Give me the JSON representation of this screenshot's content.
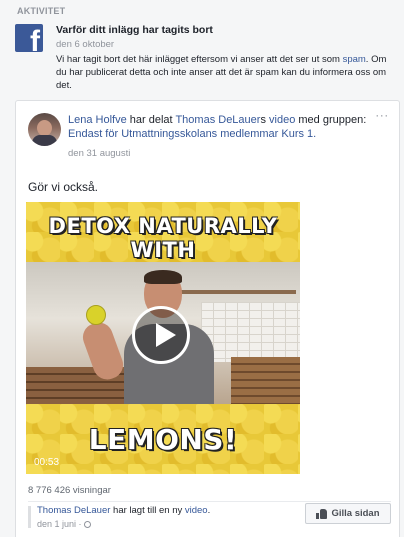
{
  "section_label": "AKTIVITET",
  "notice": {
    "logo_letter": "f",
    "title": "Varför ditt inlägg har tagits bort",
    "date": "den 6 oktober",
    "body_pre": "Vi har tagit bort det här inlägget eftersom vi anser att det ser ut som ",
    "body_link": "spam",
    "body_post": ". Om du har publicerat detta och inte anser att det är spam kan du informera oss om det."
  },
  "post": {
    "author": "Lena Holfve",
    "shared_text": " har delat ",
    "video_owner": "Thomas DeLauer",
    "video_owner_suffix": "s ",
    "video_word": "video",
    "group_text": " med gruppen: ",
    "group_name": "Endast för Utmattningsskolans medlemmar Kurs 1.",
    "date": "den 31 augusti",
    "text": "Gör vi också.",
    "more_icon": "···",
    "video": {
      "title_top": "DETOX NATURALLY WITH",
      "title_bottom": "LEMONS!",
      "duration": "00:53"
    },
    "views": "8 776 426 visningar",
    "sub_post": {
      "author": "Thomas DeLauer",
      "text": " har lagt till en ny ",
      "link": "video",
      "suffix": ".",
      "date": "den 1 juni",
      "date_suffix": " · "
    },
    "like_page_label": "Gilla sidan"
  },
  "colors": {
    "facebook_blue": "#3b5998",
    "link": "#365899",
    "muted": "#90949c"
  }
}
